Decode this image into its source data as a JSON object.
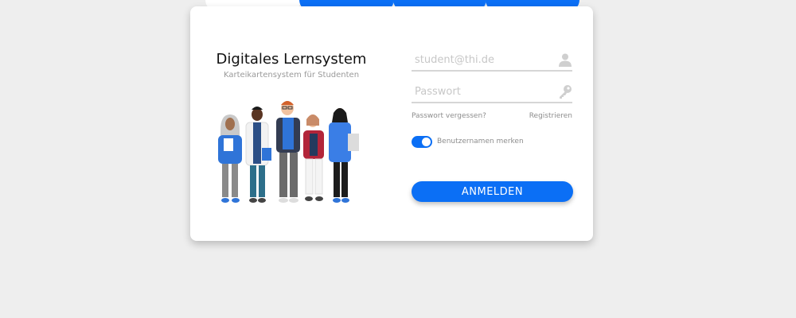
{
  "colors": {
    "accent": "#0b6ff5",
    "background": "#eeeeee",
    "card": "#ffffff"
  },
  "header": {
    "title": "Digitales Lernsystem",
    "subtitle": "Karteikartensystem für Studenten"
  },
  "illustration": {
    "icon": "students-group-illustration"
  },
  "login": {
    "username": {
      "placeholder": "student@thi.de",
      "value": "",
      "icon": "user-icon"
    },
    "password": {
      "placeholder": "Passwort",
      "value": "",
      "icon": "key-icon"
    },
    "forgot_label": "Passwort vergessen?",
    "register_label": "Registrieren",
    "remember": {
      "label": "Benutzernamen merken",
      "checked": true
    },
    "submit_label": "ANMELDEN"
  }
}
